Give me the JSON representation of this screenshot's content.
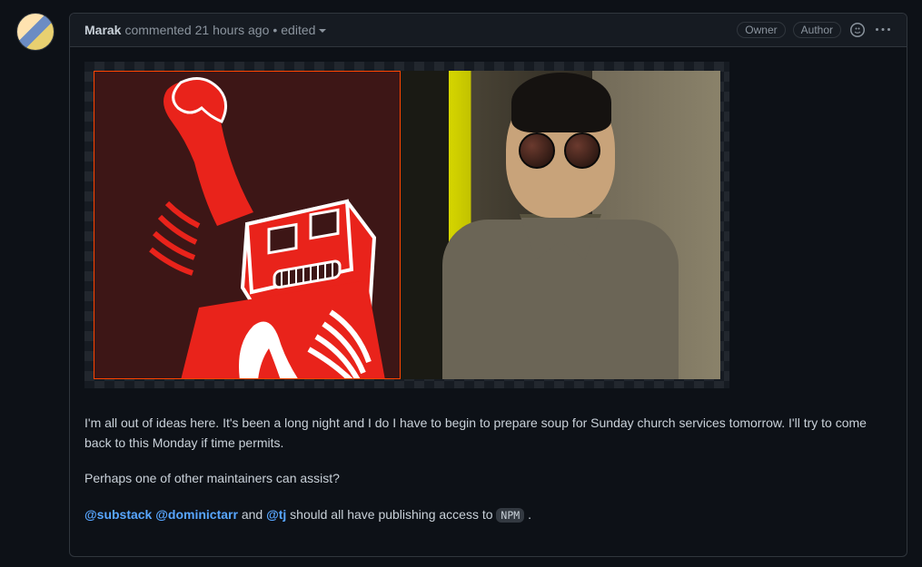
{
  "header": {
    "author": "Marak",
    "action": "commented",
    "timestamp": "21 hours ago",
    "edited_sep": "•",
    "edited": "edited",
    "badges": {
      "owner": "Owner",
      "author": "Author"
    }
  },
  "body": {
    "p1": "I'm all out of ideas here. It's been a long night and I do I have to begin to prepare soup for Sunday church services tomorrow. I'll try to come back to this Monday if time permits.",
    "p2": "Perhaps one of other maintainers can assist?",
    "p3": {
      "m1": "@substack",
      "m2": "@dominictarr",
      "t1": " and ",
      "m3": "@tj",
      "t2": " should all have publishing access to ",
      "code": "NPM",
      "t3": " ."
    }
  }
}
